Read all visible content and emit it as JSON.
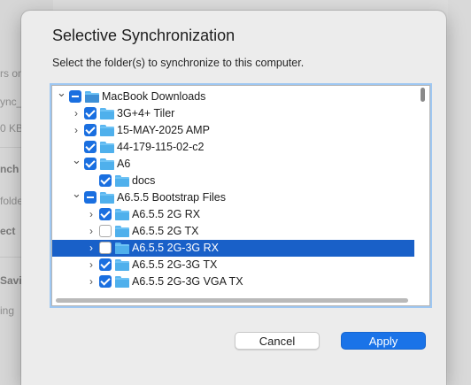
{
  "background": {
    "fragments": [
      "rs on",
      "ync_",
      "0 KB",
      "nch",
      "folde",
      "ect",
      "Savi",
      "ing"
    ]
  },
  "dialog": {
    "title": "Selective Synchronization",
    "subtitle": "Select the folder(s) to synchronize to this computer.",
    "tree": [
      {
        "label": "MacBook Downloads",
        "state": "mixed",
        "expand": "expanded",
        "level": 0,
        "folder": "mac"
      },
      {
        "label": "3G+4+ Tiler",
        "state": "checked",
        "expand": "collapsed",
        "level": 1
      },
      {
        "label": "15-MAY-2025 AMP",
        "state": "checked",
        "expand": "collapsed",
        "level": 1
      },
      {
        "label": "44-179-115-02-c2",
        "state": "checked",
        "expand": "none",
        "level": 1
      },
      {
        "label": "A6",
        "state": "checked",
        "expand": "expanded",
        "level": 1
      },
      {
        "label": "docs",
        "state": "checked",
        "expand": "none",
        "level": 2
      },
      {
        "label": "A6.5.5 Bootstrap Files",
        "state": "mixed",
        "expand": "expanded",
        "level": 1
      },
      {
        "label": "A6.5.5 2G RX",
        "state": "checked",
        "expand": "collapsed",
        "level": 2
      },
      {
        "label": "A6.5.5 2G TX",
        "state": "unchecked",
        "expand": "collapsed",
        "level": 2
      },
      {
        "label": "A6.5.5 2G-3G RX",
        "state": "unchecked",
        "expand": "collapsed",
        "level": 2,
        "selected": true
      },
      {
        "label": "A6.5.5 2G-3G TX",
        "state": "checked",
        "expand": "collapsed",
        "level": 2
      },
      {
        "label": "A6.5.5 2G-3G VGA TX",
        "state": "checked",
        "expand": "collapsed",
        "level": 2
      }
    ],
    "cancel_label": "Cancel",
    "apply_label": "Apply"
  },
  "colors": {
    "accent": "#1a73e8",
    "selection": "#1960c8",
    "folder": "#4fb0ec"
  }
}
